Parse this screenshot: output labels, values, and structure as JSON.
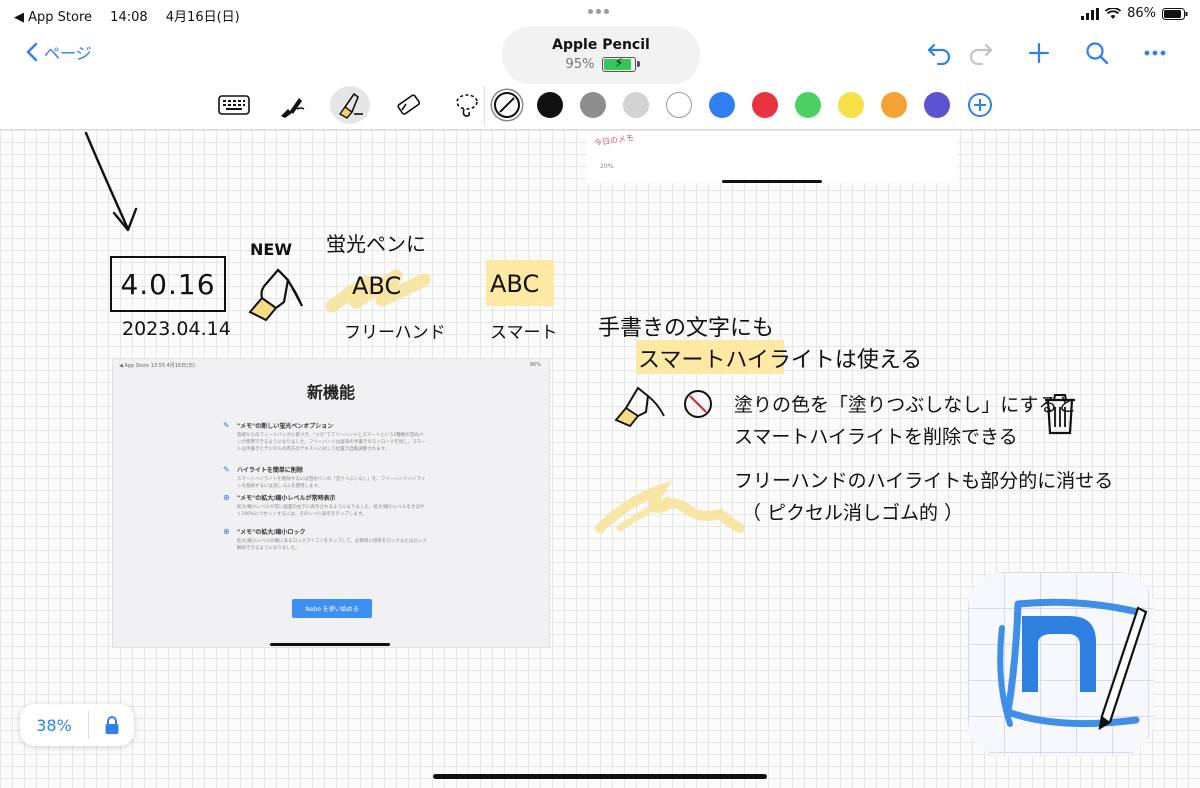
{
  "status_bar": {
    "back_app": "◀ App Store",
    "time": "14:08",
    "date": "4月16日(日)",
    "battery": "86%"
  },
  "nav": {
    "back_label": "ページ"
  },
  "pencil": {
    "name": "Apple Pencil",
    "battery": "95%"
  },
  "toolbar": {
    "tools": [
      "keyboard-icon",
      "pen-icon",
      "highlighter-icon",
      "eraser-icon",
      "lasso-icon"
    ],
    "active_tool": "highlighter-icon",
    "colors": [
      {
        "name": "none",
        "hex": "#ffffff"
      },
      {
        "name": "black",
        "hex": "#111111"
      },
      {
        "name": "gray",
        "hex": "#8e8e8e"
      },
      {
        "name": "light-gray",
        "hex": "#d3d3d3"
      },
      {
        "name": "white",
        "hex": "#ffffff"
      },
      {
        "name": "blue",
        "hex": "#2f7ff0"
      },
      {
        "name": "red",
        "hex": "#e8343f"
      },
      {
        "name": "green",
        "hex": "#4cd262"
      },
      {
        "name": "yellow",
        "hex": "#f6df47"
      },
      {
        "name": "orange",
        "hex": "#f4a236"
      },
      {
        "name": "purple",
        "hex": "#5c52d3"
      }
    ],
    "selected_color": "none"
  },
  "canvas": {
    "version": "4.0.16",
    "date": "2023.04.14",
    "new_label": "NEW",
    "highlighter_caption": "蛍光ペンに",
    "abc_freehand": "ABC",
    "abc_smart": "ABC",
    "freehand_label": "フリーハンド",
    "smart_label": "スマート",
    "note_line1": "手書きの文字にも",
    "note_line2_hl": "スマートハイライト",
    "note_line2_rest": "は使える",
    "delete_line1": "塗りの色を「塗りつぶしなし」にすると",
    "delete_line2": "スマートハイライトを削除できる",
    "erase_line1": "フリーハンドのハイライトも部分的に消せる",
    "erase_line2": "（ ピクセル消しゴム的 ）",
    "embedded_top_text": "今日のメモ",
    "embedded_top_pct": "20%"
  },
  "embedded_screenshot": {
    "status_left": "◀ App Store  13:55  4月16日(日)",
    "status_right": "90%",
    "title": "新機能",
    "features": [
      {
        "icon": "highlighter-icon",
        "heading": "\"メモ\"の新しい蛍光ペンオプション",
        "body": "皆様からのフィードバックに基づき、\"メモ\"でフリーハンドとスマートという2種類の蛍光ペンが使用できるようになりました。フリーハンドは従来の手書きのストロークを残し、スマートは手書きとデジタルの両方のテキストに対して位置が自動調整されます。"
      },
      {
        "icon": "highlighter-icon",
        "heading": "ハイライトを簡単に削除",
        "body": "スマートハイライトを削除するには蛍光ペンの「塗りつぶしなし」を、フリーハンドハイライトを削除するには消しゴムを使用します。"
      },
      {
        "icon": "zoom-icon",
        "heading": "\"メモ\"の拡大/縮小レベルが常時表示",
        "body": "拡大/縮小レベルが常に画面の左下に表示されるようになりました。拡大/縮小レベルをすばやく100%にリセットするには、そのレベル表示をタップします。"
      },
      {
        "icon": "zoom-icon",
        "heading": "\"メモ\"の拡大/縮小ロック",
        "body": "拡大/縮小レベルの横にあるロックアイコンをタップして、必要時に倍率をロックまたはロック解除できるようになりました。"
      }
    ],
    "button": "Nebo を使い始める"
  },
  "zoom": {
    "level": "38%"
  },
  "app_icon": {
    "name": "nebo-app-icon",
    "letter": "n"
  }
}
